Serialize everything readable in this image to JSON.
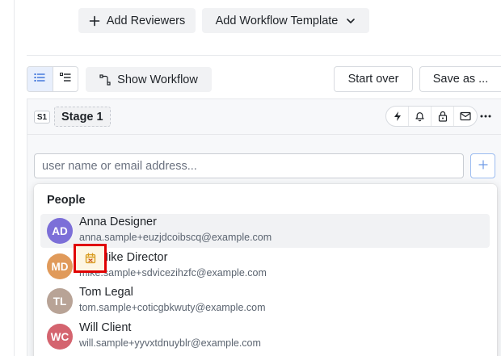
{
  "toolbar": {
    "add_reviewers_label": "Add Reviewers",
    "add_workflow_template_label": "Add Workflow Template",
    "show_workflow_label": "Show Workflow",
    "start_over_label": "Start over",
    "save_as_label": "Save as ..."
  },
  "stage": {
    "badge": "S1",
    "name": "Stage 1",
    "actions": [
      "lightning-icon",
      "bell-icon",
      "lock-icon",
      "mail-icon"
    ]
  },
  "search": {
    "placeholder": "user name or email address..."
  },
  "people": {
    "title": "People",
    "items": [
      {
        "initials": "AD",
        "name": "Anna Designer",
        "email": "anna.sample+euzjdcoibscq@example.com",
        "color": "#7c6fd8"
      },
      {
        "initials": "MD",
        "name": "Mike Director",
        "email": "mike.sample+sdvicezihzfc@example.com",
        "color": "#e09a5a"
      },
      {
        "initials": "TL",
        "name": "Tom Legal",
        "email": "tom.sample+coticgbkwuty@example.com",
        "color": "#b8a396"
      },
      {
        "initials": "WC",
        "name": "Will Client",
        "email": "will.sample+yyvxtdnuyblr@example.com",
        "color": "#d4646f"
      }
    ]
  },
  "colors": {
    "accent": "#3b72d9",
    "highlight_box": "#e00000"
  }
}
